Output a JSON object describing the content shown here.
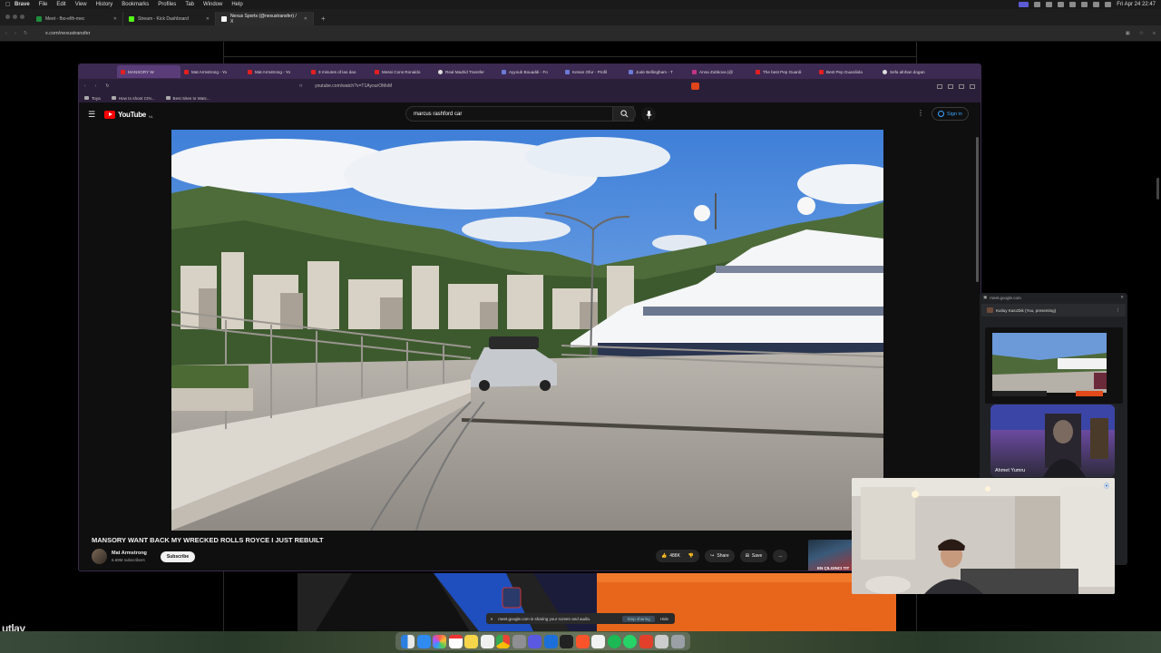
{
  "menubar": {
    "app": "Brave",
    "items": [
      "File",
      "Edit",
      "View",
      "History",
      "Bookmarks",
      "Profiles",
      "Tab",
      "Window",
      "Help"
    ],
    "clock": "Fri Apr 24  22:47"
  },
  "outer_browser": {
    "tabs": [
      {
        "label": "Meet - fbo-efih-mec",
        "color": "#1e8e3e"
      },
      {
        "label": "Stream - Kick Dashboard",
        "color": "#53fc18"
      },
      {
        "label": "Nexus Sports (@nexustransfer) / X",
        "color": "#ffffff"
      }
    ],
    "url": "x.com/nexustransfer",
    "partial_text": "utlay"
  },
  "inner_browser": {
    "tabs": [
      {
        "label": "MANSORY W",
        "icon": "youtube"
      },
      {
        "label": "Mat Armstrong - Yo",
        "icon": "youtube"
      },
      {
        "label": "Mat Armstrong - Yo",
        "icon": "youtube"
      },
      {
        "label": "3 minutes of lao dao",
        "icon": "youtube"
      },
      {
        "label": "Messi Cons Ronaldo",
        "icon": "youtube"
      },
      {
        "label": "Real Madrid Transfer",
        "icon": "web"
      },
      {
        "label": "Ayyoub Bouaddi - Fo",
        "icon": "web2"
      },
      {
        "label": "Kenan Ofur - Profil",
        "icon": "web2"
      },
      {
        "label": "Jude Bellingham - T",
        "icon": "web2"
      },
      {
        "label": "Anna Zubkova (@",
        "icon": "instagram"
      },
      {
        "label": "The best Pep Guardi",
        "icon": "youtube"
      },
      {
        "label": "Best Pep Guardiola",
        "icon": "youtube"
      },
      {
        "label": "Sefa altıhan dogan",
        "icon": "web"
      }
    ],
    "url": "youtube.com/watch?v=T1AyourOMoM",
    "bookmarks": [
      "Toya",
      "How to shoot CIN...",
      "Best Sites to Watc..."
    ]
  },
  "youtube": {
    "logo": "YouTube",
    "country_code": "NL",
    "search_query": "marcus rashford car",
    "signin_label": "Sign in",
    "video_title": "MANSORY WANT BACK MY WRECKED ROLLS ROYCE I JUST REBUILT",
    "channel_name": "Mat Armstrong",
    "subscribers": "6.69M subscribers",
    "subscribe_label": "Subscribe",
    "likes": "488K",
    "share_label": "Share",
    "save_label": "Save",
    "more_label": "...",
    "up_next_thumb_text": "EN ÇILGINCI TIT"
  },
  "meet": {
    "source": "meet.google.com",
    "presenting_label": "Kutluy Kasızbik (You, presenting)",
    "participant_name": "Ahmet Yumru",
    "screen_share_notice": "meet.google.com is sharing your screen and audio.",
    "stop_sharing_label": "Stop sharing",
    "hide_label": "Hide"
  },
  "dock": {
    "apps": [
      "finder",
      "safari",
      "photos",
      "calendar",
      "notes",
      "reminders",
      "chrome",
      "settings",
      "launchpad",
      "xcode",
      "terminal",
      "brave",
      "spotify",
      "whatsapp",
      "brave-beta",
      "files",
      "trash"
    ]
  }
}
